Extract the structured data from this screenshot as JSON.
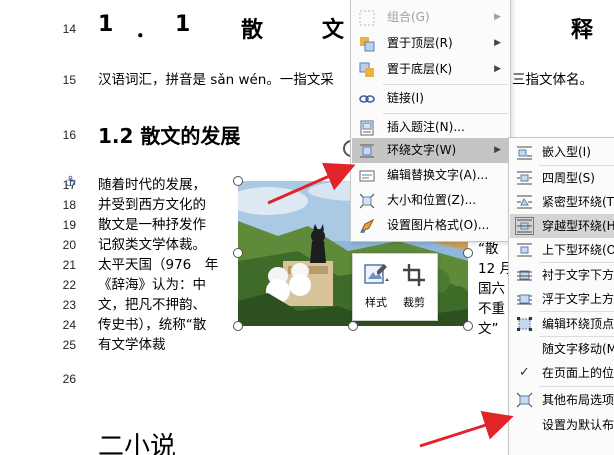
{
  "document": {
    "line_numbers": [
      "14",
      "15",
      "16",
      "17",
      "18",
      "19",
      "20",
      "21",
      "22",
      "23",
      "24",
      "25",
      "26"
    ],
    "heading1": {
      "chars": [
        "1",
        "．",
        "1",
        "散",
        "文",
        "释"
      ]
    },
    "line15": "汉语词汇，拼音是 sǎn wén。一指文采",
    "line15_right": "三指文体名。",
    "heading2": "1.2 散文的发展",
    "body_lines": [
      "随着时代的发展，",
      "并受到西方文化的",
      "散文是一种抒发作",
      "记叙类文学体裁。",
      "太平天国（976　年",
      "《辞海》认为：中",
      "文，把凡不押韵、",
      "传史书），统称“散",
      "有文学体裁"
    ],
    "right_fragments": [
      "“散",
      "12 月",
      "国六",
      "不重",
      "文”"
    ],
    "bottom_heading": "二小说"
  },
  "mini_toolbar": {
    "style_label": "样式",
    "crop_label": "裁剪"
  },
  "context_menu": {
    "items": [
      {
        "label": "组合(G)",
        "disabled": true,
        "has_submenu": true
      },
      {
        "label": "置于顶层(R)",
        "disabled": false,
        "has_submenu": true
      },
      {
        "label": "置于底层(K)",
        "disabled": false,
        "has_submenu": true
      },
      {
        "label": "链接(I)",
        "disabled": false,
        "has_submenu": false
      },
      {
        "label": "插入题注(N)...",
        "disabled": false,
        "has_submenu": false
      },
      {
        "label": "环绕文字(W)",
        "disabled": false,
        "has_submenu": true,
        "highlighted": true
      },
      {
        "label": "编辑替换文字(A)...",
        "disabled": false,
        "has_submenu": false
      },
      {
        "label": "大小和位置(Z)...",
        "disabled": false,
        "has_submenu": false
      },
      {
        "label": "设置图片格式(O)...",
        "disabled": false,
        "has_submenu": false
      }
    ]
  },
  "wrap_submenu": {
    "items": [
      {
        "label": "嵌入型(I)"
      },
      {
        "label": "四周型(S)"
      },
      {
        "label": "紧密型环绕(T)"
      },
      {
        "label": "穿越型环绕(H)",
        "highlighted": true
      },
      {
        "label": "上下型环绕(O)"
      },
      {
        "label": "衬于文字下方(D)"
      },
      {
        "label": "浮于文字上方(N)"
      },
      {
        "label": "编辑环绕顶点(E)"
      },
      {
        "label": "随文字移动(M)"
      },
      {
        "label": "在页面上的位置固定(F)",
        "checked": true
      },
      {
        "label": "其他布局选项(L)..."
      },
      {
        "label": "设置为默认布局(A)"
      }
    ]
  },
  "colors": {
    "menu_highlight": "#c5c5c5",
    "annotation_arrow": "#e0242a",
    "anchor_icon": "#2b5797"
  }
}
